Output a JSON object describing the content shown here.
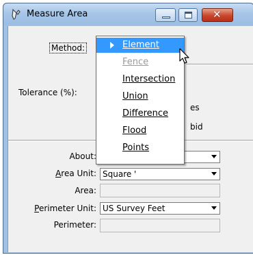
{
  "window": {
    "title": "Measure Area"
  },
  "method": {
    "label": "Method:",
    "selected": "Element"
  },
  "dropdown_options": [
    "Element",
    "Fence",
    "Intersection",
    "Union",
    "Difference",
    "Flood",
    "Points"
  ],
  "dropdown_disabled": "Fence",
  "tolerance": {
    "label": "Tolerance (%):"
  },
  "partial": {
    "line1": "es",
    "line2": "bid"
  },
  "about": {
    "label": "About:"
  },
  "area_unit": {
    "label": "Area Unit:",
    "value": "Square '"
  },
  "area": {
    "label": "Area:",
    "value": ""
  },
  "perimeter_unit": {
    "label": "Perimeter Unit:",
    "value": "US Survey Feet"
  },
  "perimeter": {
    "label": "Perimeter:",
    "value": ""
  },
  "icons": {
    "app": "measure-area-icon",
    "minimize": "minimize-icon",
    "maximize": "maximize-icon",
    "close": "close-icon"
  },
  "colors": {
    "title_bar": "#a6c6e8",
    "selection": "#3399ff",
    "close_button": "#c8452c"
  }
}
